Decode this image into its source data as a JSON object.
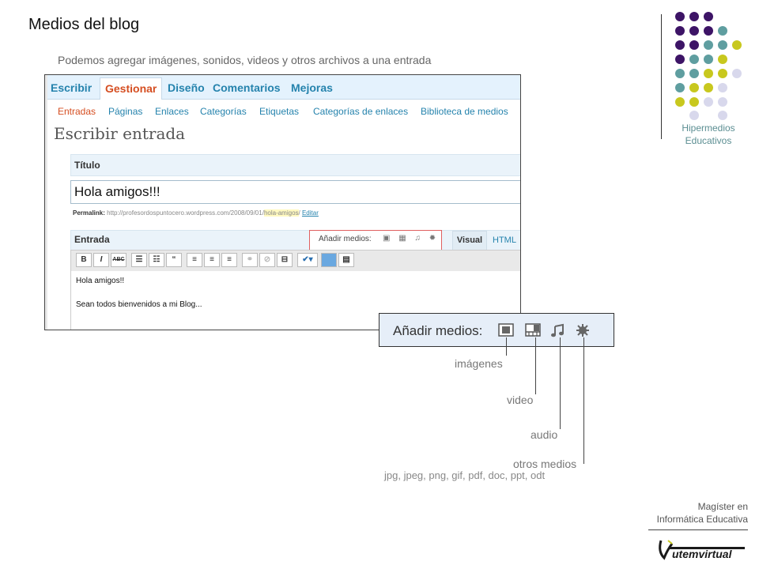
{
  "slide": {
    "title": "Medios del blog",
    "subtitle": "Podemos agregar imágenes, sonidos, videos y otros archivos a una entrada"
  },
  "brand": {
    "line1": "Hipermedios",
    "line2": "Educativos",
    "colors": {
      "purple": "#3d1466",
      "teal": "#5f9ea0",
      "olive": "#c8c81e",
      "lavender": "#d8d8ec"
    },
    "magister_line1": "Magíster en",
    "magister_line2": "Informática Educativa",
    "utem_logo_text": "utemvirtual"
  },
  "wordpress": {
    "nav_tabs": [
      "Escribir",
      "Gestionar",
      "Diseño",
      "Comentarios",
      "Mejoras"
    ],
    "active_nav": "Gestionar",
    "sub_tabs": [
      "Entradas",
      "Páginas",
      "Enlaces",
      "Categorías",
      "Etiquetas",
      "Categorías de enlaces",
      "Biblioteca de medios"
    ],
    "active_sub": "Entradas",
    "page_heading": "Escribir entrada",
    "title_label": "Título",
    "title_value": "Hola amigos!!!",
    "permalink_label": "Permalink:",
    "permalink_url": "http://profesordospuntocero.wordpress.com/2008/09/01/",
    "permalink_slug": "hola-amigos",
    "permalink_edit": "Editar",
    "entry_label": "Entrada",
    "media_label": "Añadir medios:",
    "tab_visual": "Visual",
    "tab_html": "HTML",
    "toolbar_buttons": [
      "B",
      "I",
      "ABC",
      "☰",
      "☷",
      "“",
      "≡",
      "≡",
      "≡"
    ],
    "editor_line1": "Hola amigos!!",
    "editor_line2": "Sean todos bienvenidos a mi Blog..."
  },
  "media_zoom": {
    "label": "Añadir medios:",
    "icons": [
      "image-icon",
      "video-icon",
      "music-note-icon",
      "star-burst-icon"
    ],
    "callouts": {
      "images": "imágenes",
      "video": "video",
      "audio": "audio",
      "other": "otros medios",
      "formats": "jpg, jpeg, png, gif, pdf, doc, ppt, odt"
    }
  }
}
